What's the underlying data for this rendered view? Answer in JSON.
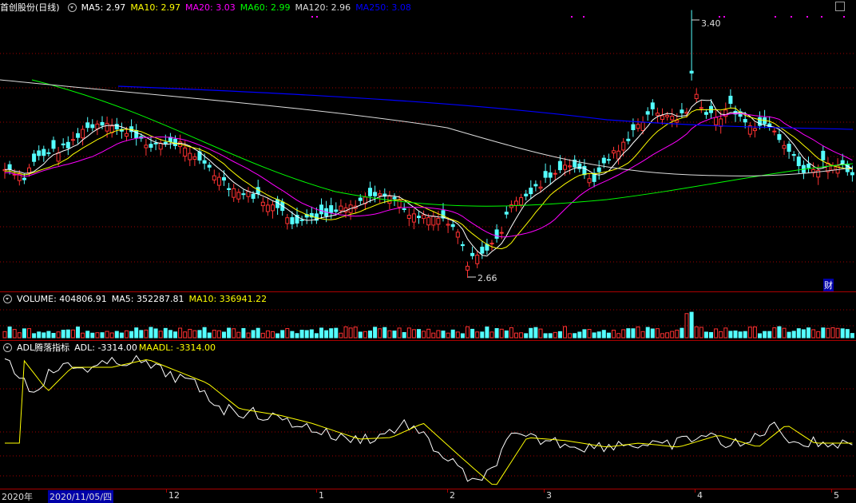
{
  "price_panel": {
    "stock_name": "首创股份",
    "period": "(日线)",
    "ma_labels": [
      {
        "text": "MA5: 2.97",
        "color": "#ffffff"
      },
      {
        "text": "MA10: 2.97",
        "color": "#ffff00"
      },
      {
        "text": "MA20: 3.03",
        "color": "#ff00ff"
      },
      {
        "text": "MA60: 2.99",
        "color": "#00ff00"
      },
      {
        "text": "MA120: 2.96",
        "color": "#dddddd"
      },
      {
        "text": "MA250: 3.08",
        "color": "#0000ff"
      }
    ],
    "high_label": "3.40",
    "low_label": "2.66",
    "cai_badge": "财"
  },
  "volume_panel": {
    "title": "VOLUME: 404806.91",
    "ma5": "MA5: 352287.81",
    "ma10": "MA10: 336941.22"
  },
  "adl_panel": {
    "title": "ADL腾落指标",
    "adl": "ADL: -3314.00",
    "maadl": "MAADL: -3314.00"
  },
  "x_axis": {
    "labels": [
      "2020年",
      "2020/11/05/四",
      "12",
      "1",
      "2",
      "3",
      "4",
      "5"
    ]
  },
  "colors": {
    "up": "#ff3232",
    "down": "#54ffff",
    "grid": "#a00000",
    "ma5": "#ffffff",
    "ma10": "#ffff00",
    "ma20": "#ff00ff",
    "ma60": "#00ff00",
    "ma120": "#dddddd",
    "ma250": "#0000ff"
  }
}
